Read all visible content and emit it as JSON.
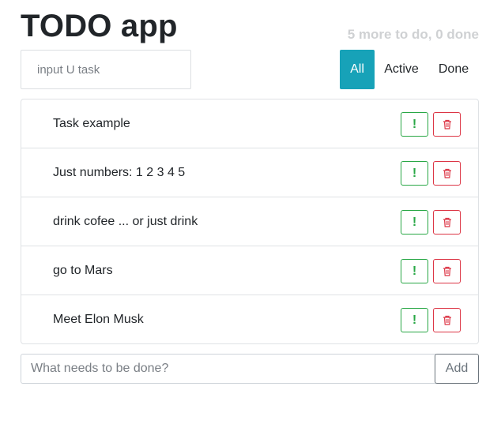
{
  "header": {
    "title": "TODO app",
    "counter": "5 more to do, 0 done"
  },
  "search": {
    "placeholder": "input U task"
  },
  "filters": [
    {
      "label": "All",
      "active": true
    },
    {
      "label": "Active",
      "active": false
    },
    {
      "label": "Done",
      "active": false
    }
  ],
  "items": [
    {
      "label": "Task example",
      "important_icon": "exclamation-icon",
      "delete_icon": "trash-icon"
    },
    {
      "label": "Just numbers: 1 2 3 4 5",
      "important_icon": "exclamation-icon",
      "delete_icon": "trash-icon"
    },
    {
      "label": "drink cofee ... or just drink",
      "important_icon": "exclamation-icon",
      "delete_icon": "trash-icon"
    },
    {
      "label": "go to Mars",
      "important_icon": "exclamation-icon",
      "delete_icon": "trash-icon"
    },
    {
      "label": "Meet Elon Musk",
      "important_icon": "exclamation-icon",
      "delete_icon": "trash-icon"
    }
  ],
  "add_form": {
    "placeholder": "What needs to be done?",
    "button_label": "Add"
  },
  "colors": {
    "accent": "#17a2b8",
    "important": "#28a745",
    "danger": "#dc3545",
    "secondary": "#6c757d",
    "counter_text": "#cfd1d3"
  }
}
